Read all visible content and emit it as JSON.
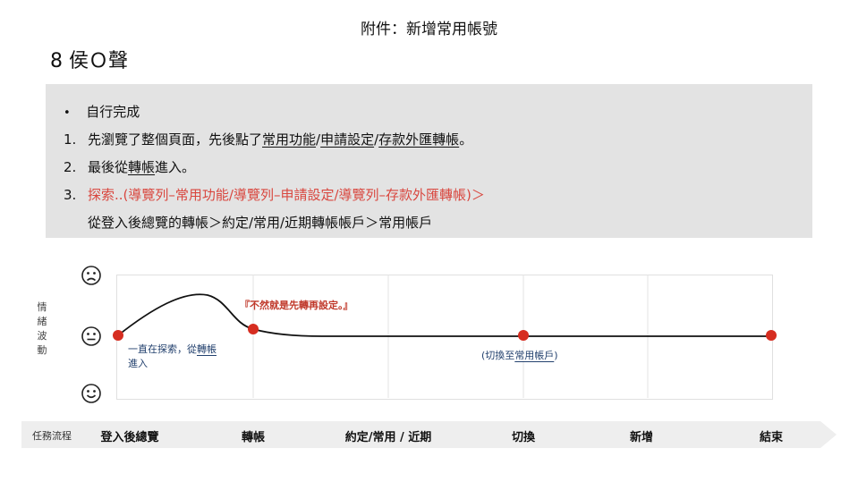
{
  "header": {
    "title": "附件：新增常用帳號"
  },
  "slide": {
    "heading": "8 侯Ｏ聲"
  },
  "summary": {
    "bullet": "自行完成",
    "steps": [
      {
        "num": "1.",
        "pre": "先瀏覽了整個頁面，先後點了",
        "a": "常用功能",
        "s1": "/",
        "b": "申請設定",
        "s2": "/",
        "c": "存款外匯轉帳",
        "post": "。"
      },
      {
        "num": "2.",
        "pre": "最後從",
        "a": "轉帳",
        "post": "進入。"
      },
      {
        "num": "3.",
        "text": "探索..(導覽列–常用功能/導覽列–申請設定/導覽列–存款外匯轉帳)＞"
      }
    ],
    "continuation": "從登入後總覽的轉帳＞約定/常用/近期轉帳帳戶＞常用帳戶"
  },
  "emotion_axis": {
    "label_chars": [
      "情",
      "緒",
      "波",
      "動"
    ],
    "levels": [
      "sad-face-icon",
      "neutral-face-icon",
      "happy-face-icon"
    ]
  },
  "annotations": {
    "explore_pre": "一直在探索，從",
    "explore_link": "轉帳",
    "explore_post": "進入",
    "complaint": "『不然就是先轉再設定。』",
    "switch_pre": "(切換至",
    "switch_link": "常用帳戶",
    "switch_post": ")"
  },
  "flow": {
    "label": "任務流程",
    "stages": [
      "登入後總覽",
      "轉帳",
      "約定/常用 / 近期",
      "切換",
      "新增",
      "結束"
    ]
  },
  "chart_data": {
    "type": "line",
    "categories": [
      "登入後總覽",
      "轉帳",
      "約定/常用 / 近期",
      "切換",
      "新增",
      "結束"
    ],
    "y_levels": [
      "sad",
      "neutral",
      "happy"
    ],
    "marked_points": [
      {
        "stage": "登入後總覽",
        "level": "neutral"
      },
      {
        "stage": "轉帳",
        "level": "neutral"
      },
      {
        "stage": "切換",
        "level": "neutral"
      },
      {
        "stage": "結束",
        "level": "neutral"
      }
    ],
    "peak": {
      "between": [
        "登入後總覽",
        "轉帳"
      ],
      "level": "toward-sad"
    },
    "grid": true,
    "colors": {
      "line": "#111111",
      "marker": "#d62d20",
      "grid": "#e3e3e3"
    }
  }
}
